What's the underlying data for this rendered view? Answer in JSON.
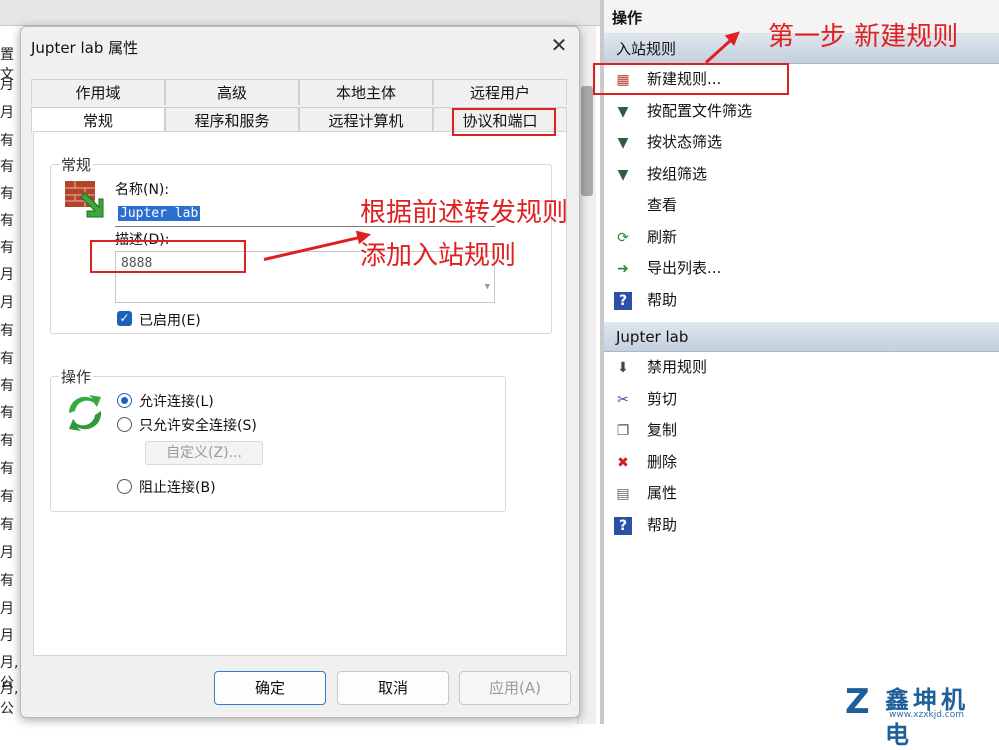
{
  "background": {
    "left_chars": [
      "置文",
      "月",
      "月",
      "有",
      "有",
      "有",
      "有",
      "有",
      "月",
      "月",
      "有",
      "有",
      "有",
      "有",
      "有",
      "有",
      "有",
      "有",
      "月",
      "有",
      "月",
      "月",
      "月,公",
      "月,公",
      "月"
    ]
  },
  "actions_pane": {
    "title": "操作",
    "section1": "入站规则",
    "items1": [
      {
        "label": "新建规则...",
        "icon": "new-rule-icon"
      },
      {
        "label": "按配置文件筛选",
        "icon": "filter-icon"
      },
      {
        "label": "按状态筛选",
        "icon": "filter-icon"
      },
      {
        "label": "按组筛选",
        "icon": "filter-icon"
      },
      {
        "label": "查看",
        "icon": ""
      },
      {
        "label": "刷新",
        "icon": "refresh-icon"
      },
      {
        "label": "导出列表...",
        "icon": "export-icon"
      },
      {
        "label": "帮助",
        "icon": "help-icon"
      }
    ],
    "section2": "Jupter lab",
    "items2": [
      {
        "label": "禁用规则",
        "icon": "disable-icon"
      },
      {
        "label": "剪切",
        "icon": "cut-icon"
      },
      {
        "label": "复制",
        "icon": "copy-icon"
      },
      {
        "label": "删除",
        "icon": "delete-icon"
      },
      {
        "label": "属性",
        "icon": "properties-icon"
      },
      {
        "label": "帮助",
        "icon": "help-icon"
      }
    ]
  },
  "dialog": {
    "title": "Jupter lab 属性",
    "close_glyph": "✕",
    "tabs_row1": [
      "作用域",
      "高级",
      "本地主体",
      "远程用户"
    ],
    "tabs_row2": [
      "常规",
      "程序和服务",
      "远程计算机",
      "协议和端口"
    ],
    "general_group": "常规",
    "name_label": "名称(N):",
    "name_value": "Jupter lab",
    "desc_label": "描述(D):",
    "desc_value": "8888",
    "enabled_label": "已启用(E)",
    "action_group": "操作",
    "radio_allow": "允许连接(L)",
    "radio_allow_secure": "只允许安全连接(S)",
    "custom_button": "自定义(Z)...",
    "radio_block": "阻止连接(B)",
    "ok_button": "确定",
    "cancel_button": "取消",
    "apply_button": "应用(A)"
  },
  "annotations": {
    "step1": "第一步 新建规则",
    "step2_line1": "根据前述转发规则",
    "step2_line2": "添加入站规则"
  },
  "watermark": {
    "brand": "鑫坤机电",
    "url": "www.xzxkjd.com"
  }
}
